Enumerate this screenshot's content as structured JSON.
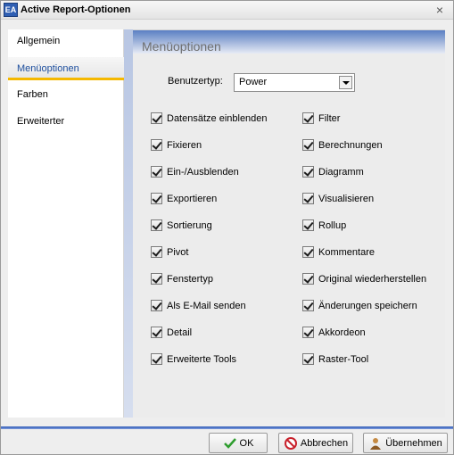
{
  "window": {
    "title": "Active Report-Optionen",
    "app_icon_text": "EA",
    "close_glyph": "×"
  },
  "sidebar": {
    "items": [
      {
        "label": "Allgemein",
        "active": false
      },
      {
        "label": "Menüoptionen",
        "active": true
      },
      {
        "label": "Farben",
        "active": false
      },
      {
        "label": "Erweiterter",
        "active": false
      }
    ]
  },
  "main": {
    "section_title": "Menüoptionen",
    "user_type_label": "Benutzertyp:",
    "user_type_value": "Power",
    "options_left": [
      {
        "label": "Datensätze einblenden",
        "checked": true
      },
      {
        "label": "Fixieren",
        "checked": true
      },
      {
        "label": "Ein-/Ausblenden",
        "checked": true
      },
      {
        "label": "Exportieren",
        "checked": true
      },
      {
        "label": "Sortierung",
        "checked": true
      },
      {
        "label": "Pivot",
        "checked": true
      },
      {
        "label": "Fenstertyp",
        "checked": true
      },
      {
        "label": "Als E-Mail senden",
        "checked": true
      },
      {
        "label": "Detail",
        "checked": true
      },
      {
        "label": "Erweiterte Tools",
        "checked": true
      }
    ],
    "options_right": [
      {
        "label": "Filter",
        "checked": true
      },
      {
        "label": "Berechnungen",
        "checked": true
      },
      {
        "label": "Diagramm",
        "checked": true
      },
      {
        "label": "Visualisieren",
        "checked": true
      },
      {
        "label": "Rollup",
        "checked": true
      },
      {
        "label": "Kommentare",
        "checked": true
      },
      {
        "label": "Original wiederherstellen",
        "checked": true
      },
      {
        "label": "Änderungen speichern",
        "checked": true
      },
      {
        "label": "Akkordeon",
        "checked": true
      },
      {
        "label": "Raster-Tool",
        "checked": true
      }
    ]
  },
  "footer": {
    "ok_label": "OK",
    "cancel_label": "Abbrechen",
    "apply_label": "Übernehmen"
  },
  "colors": {
    "accent_active_tab": "#f5b800",
    "header_gradient": "#5a7fc3",
    "footer_line": "#2c58b6",
    "ok_check": "#2e9d2e",
    "cancel_red": "#c8202b"
  },
  "icons": {
    "ok": "checkmark-icon",
    "cancel": "no-entry-icon",
    "apply": "user-icon",
    "close": "close-icon",
    "dropdown": "chevron-down-icon"
  }
}
